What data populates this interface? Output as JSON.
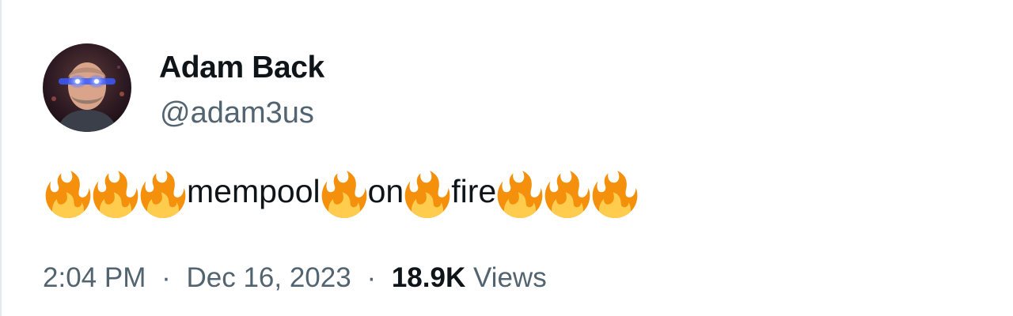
{
  "author": {
    "display_name": "Adam Back",
    "handle": "@adam3us",
    "avatar_icon": "avatar-photo-laser-eyes"
  },
  "tweet": {
    "segments": [
      {
        "type": "emoji",
        "icon": "fire-icon"
      },
      {
        "type": "emoji",
        "icon": "fire-icon"
      },
      {
        "type": "emoji",
        "icon": "fire-icon"
      },
      {
        "type": "text",
        "text": "mempool"
      },
      {
        "type": "emoji",
        "icon": "fire-icon"
      },
      {
        "type": "text",
        "text": "on"
      },
      {
        "type": "emoji",
        "icon": "fire-icon"
      },
      {
        "type": "text",
        "text": "fire"
      },
      {
        "type": "emoji",
        "icon": "fire-icon"
      },
      {
        "type": "emoji",
        "icon": "fire-icon"
      },
      {
        "type": "emoji",
        "icon": "fire-icon"
      }
    ]
  },
  "meta": {
    "time": "2:04 PM",
    "separator": "·",
    "date": "Dec 16, 2023",
    "views_count": "18.9K",
    "views_label": "Views"
  },
  "colors": {
    "text_primary": "#0f1419",
    "text_secondary": "#536471",
    "fire_outer": "#f4900c",
    "fire_inner": "#ffcc4d",
    "laser": "#3b5bff"
  }
}
